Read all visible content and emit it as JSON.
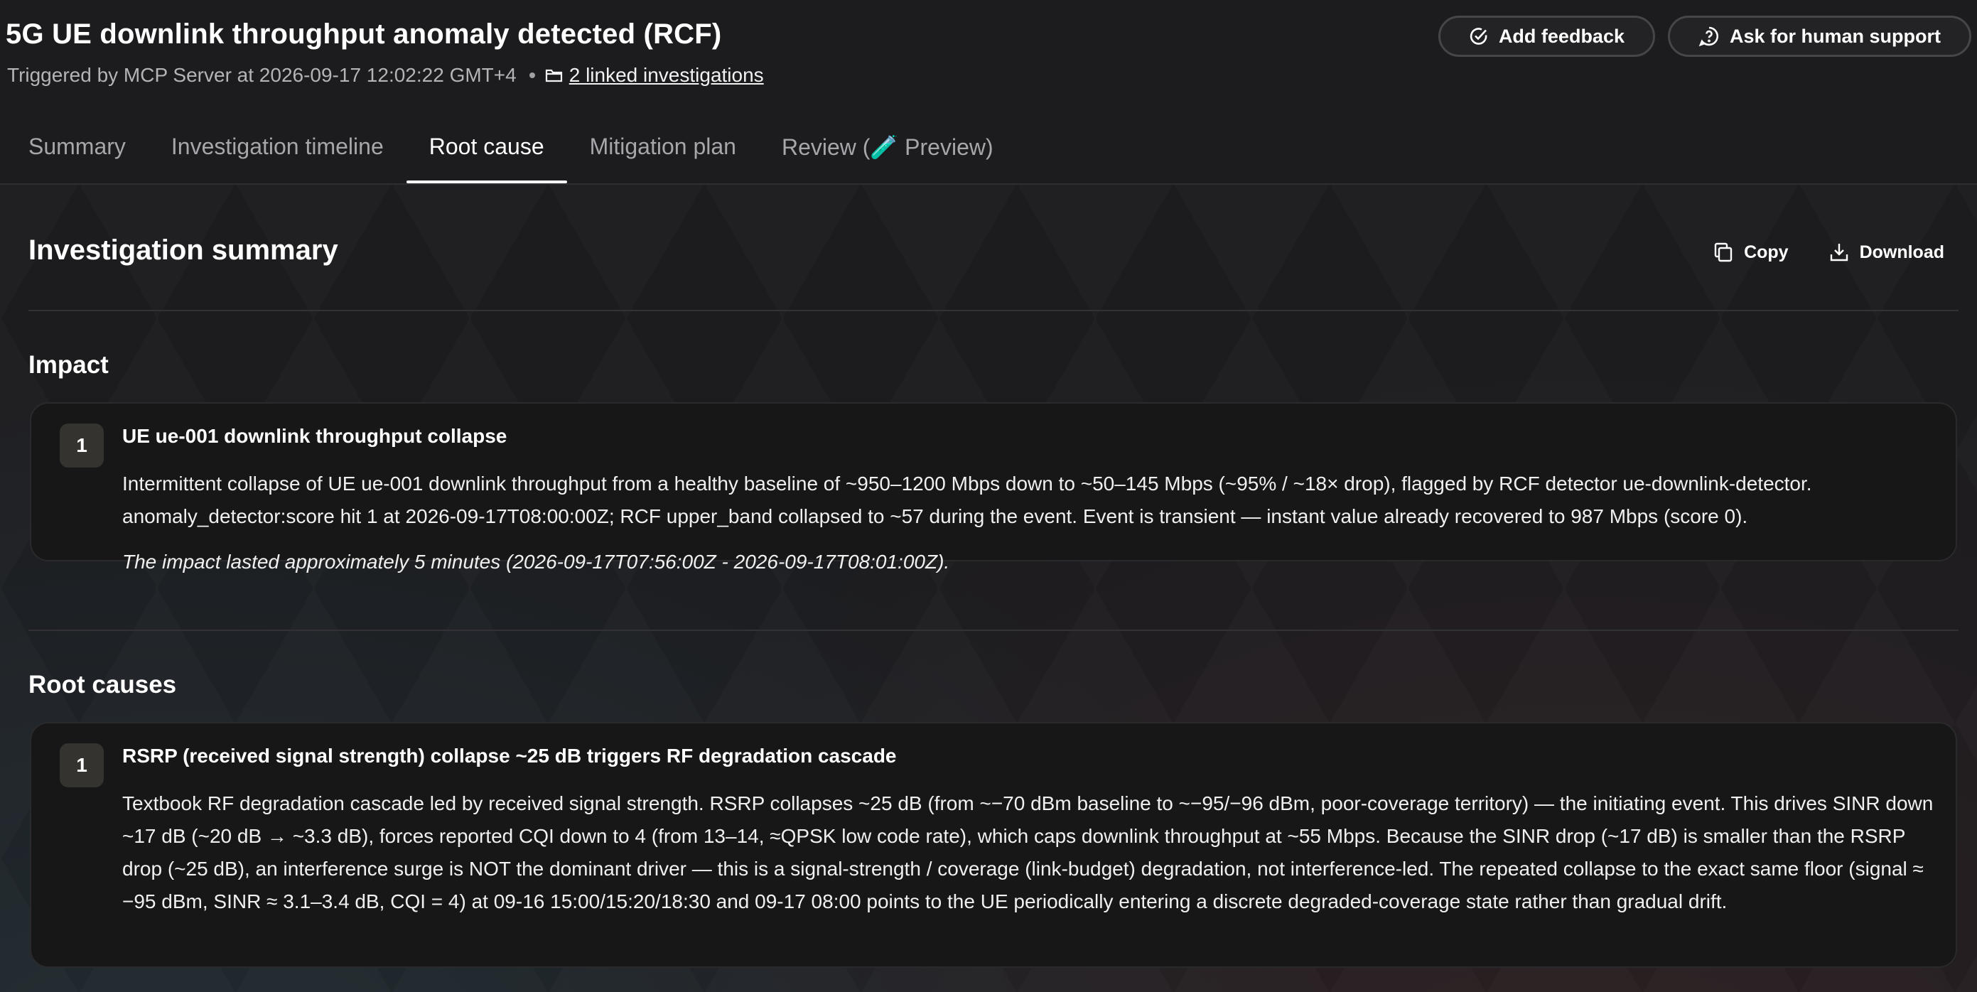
{
  "header": {
    "title": "5G UE downlink throughput anomaly detected (RCF)",
    "triggered_by": "Triggered by MCP Server at 2026-09-17 12:02:22 GMT+4",
    "linked_investigations": "2 linked investigations",
    "add_feedback_label": "Add feedback",
    "human_support_label": "Ask for human support"
  },
  "tabs": [
    {
      "label": "Summary"
    },
    {
      "label": "Investigation timeline"
    },
    {
      "label": "Root cause",
      "active": true
    },
    {
      "label": "Mitigation plan"
    },
    {
      "label": "Review (🧪 Preview)"
    }
  ],
  "summary": {
    "title": "Investigation summary",
    "copy_label": "Copy",
    "download_label": "Download"
  },
  "impact": {
    "title": "Impact",
    "items": [
      {
        "number": "1",
        "heading": "UE ue-001 downlink throughput collapse",
        "body": "Intermittent collapse of UE ue-001 downlink throughput from a healthy baseline of ~950–1200 Mbps down to ~50–145 Mbps (~95% / ~18× drop), flagged by RCF detector ue-downlink-detector. anomaly_detector:score hit 1 at 2026-09-17T08:00:00Z; RCF upper_band collapsed to ~57 during the event. Event is transient — instant value already recovered to 987 Mbps (score 0).",
        "duration": "The impact lasted approximately 5 minutes (2026-09-17T07:56:00Z - 2026-09-17T08:01:00Z)."
      }
    ]
  },
  "root_causes": {
    "title": "Root causes",
    "items": [
      {
        "number": "1",
        "heading": "RSRP (received signal strength) collapse ~25 dB triggers RF degradation cascade",
        "body": "Textbook RF degradation cascade led by received signal strength. RSRP collapses ~25 dB (from ~−70 dBm baseline to ~−95/−96 dBm, poor-coverage territory) — the initiating event. This drives SINR down ~17 dB (~20 dB → ~3.3 dB), forces reported CQI down to 4 (from 13–14, ≈QPSK low code rate), which caps downlink throughput at ~55 Mbps. Because the SINR drop (~17 dB) is smaller than the RSRP drop (~25 dB), an interference surge is NOT the dominant driver — this is a signal-strength / coverage (link-budget) degradation, not interference-led. The repeated collapse to the exact same floor (signal ≈ −95 dBm, SINR ≈ 3.1–3.4 dB, CQI = 4) at 09-16 15:00/15:20/18:30 and 09-17 08:00 points to the UE periodically entering a discrete degraded-coverage state rather than gradual drift."
      }
    ]
  }
}
